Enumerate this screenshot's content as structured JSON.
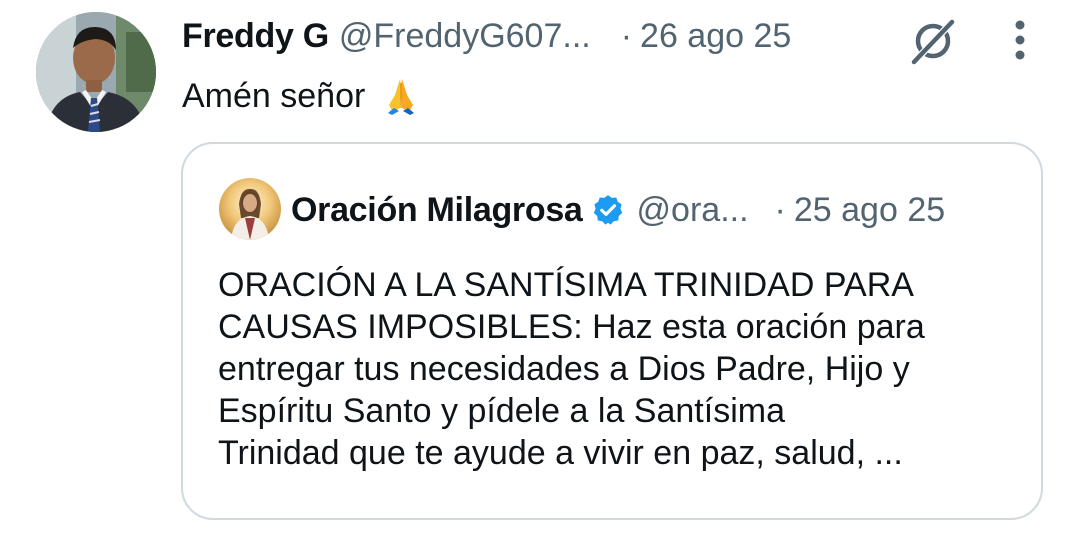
{
  "tweet": {
    "author_name": "Freddy G",
    "author_handle": "@FreddyG607...",
    "separator": "·",
    "date": "26 ago 25",
    "text": "Amén señor",
    "emoji": "folded-hands-emoji",
    "icons": {
      "avatar": "profile-photo",
      "grok": "grok-icon",
      "more": "more-options-icon"
    }
  },
  "quoted_tweet": {
    "author_name": "Oración Milagrosa",
    "verified": true,
    "author_handle": "@ora...",
    "separator": "·",
    "date": "25 ago 25",
    "text": "ORACIÓN A LA SANTÍSIMA TRINIDAD PARA\nCAUSAS IMPOSIBLES: Haz esta oración para\nentregar tus necesidades a Dios Padre, Hijo y\nEspíritu Santo y pídele a la Santísima\nTrinidad que te ayude a vivir en paz, salud, ...",
    "icons": {
      "avatar": "profile-photo",
      "verified": "verified-badge-icon"
    }
  },
  "colors": {
    "text_primary": "#0f1419",
    "text_secondary": "#536471",
    "border": "#cfd9de",
    "verified_blue": "#1d9bf0"
  }
}
